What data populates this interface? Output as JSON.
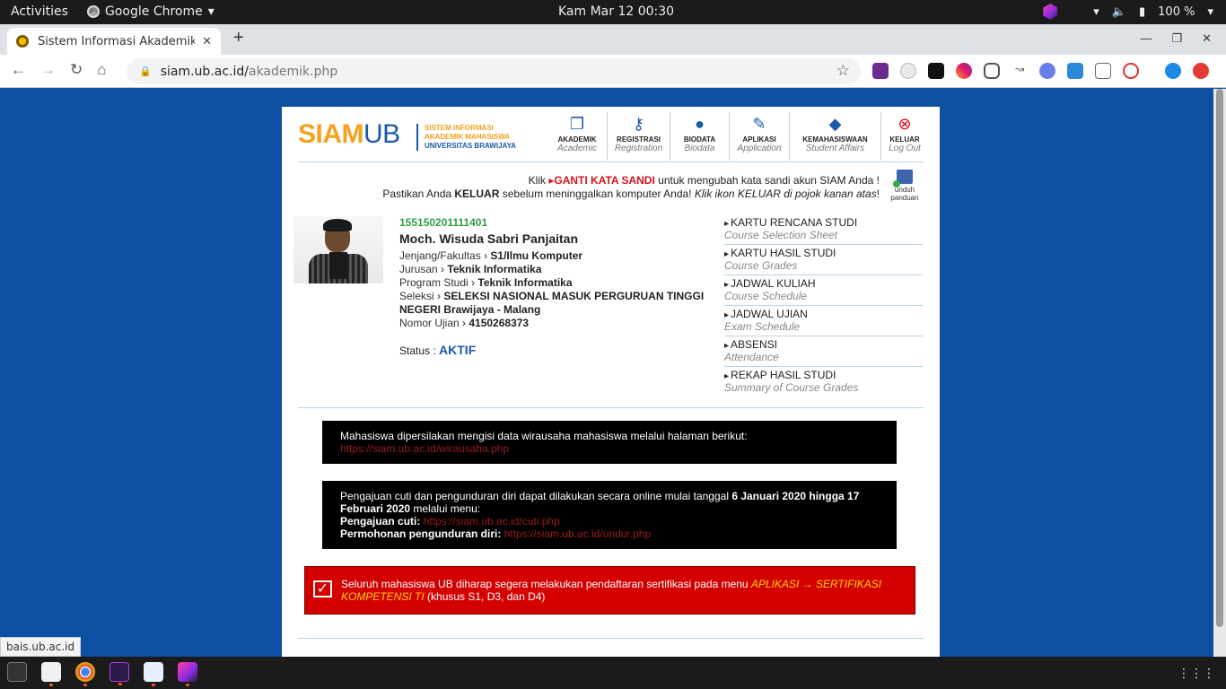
{
  "system": {
    "activities": "Activities",
    "app_name": "Google Chrome",
    "clock": "Kam Mar 12  00:30",
    "battery": "100 %"
  },
  "browser": {
    "tab_title": "Sistem Informasi Akademik",
    "url_host": "siam.ub.ac.id/",
    "url_path": "akademik.php",
    "status_url": "bais.ub.ac.id"
  },
  "logo": {
    "siam": "SIAM",
    "ub": "UB",
    "line1": "SISTEM INFORMASI",
    "line2": "AKADEMIK MAHASISWA",
    "line3": "UNIVERSITAS BRAWIJAYA"
  },
  "nav": [
    {
      "label": "AKADEMIK",
      "en": "Academic",
      "icon": "copy-icon"
    },
    {
      "label": "REGISTRASI",
      "en": "Registration",
      "icon": "key-icon"
    },
    {
      "label": "BIODATA",
      "en": "Biodata",
      "icon": "user-icon"
    },
    {
      "label": "APLIKASI",
      "en": "Application",
      "icon": "wrench-icon"
    },
    {
      "label": "KEMAHASISWAAN",
      "en": "Student Affairs",
      "icon": "graduation-cap-icon"
    },
    {
      "label": "KELUAR",
      "en": "Log Out",
      "icon": "close-circle-icon"
    }
  ],
  "notice": {
    "klik": "Klik",
    "ganti": "GANTI KATA SANDI",
    "line1_rest": "untuk mengubah kata sandi akun SIAM Anda !",
    "line2_a": "Pastikan Anda",
    "keluar": "KELUAR",
    "line2_b": "sebelum meninggalkan komputer Anda!",
    "line2_c": "Klik ikon KELUAR di pojok kanan atas",
    "line2_d": "!",
    "panduan1": "unduh",
    "panduan2": "panduan"
  },
  "student": {
    "nim": "155150201111401",
    "name": "Moch. Wisuda Sabri Panjaitan",
    "jenjang_label": "Jenjang/Fakultas",
    "jenjang": "S1/Ilmu Komputer",
    "jurusan_label": "Jurusan",
    "jurusan": "Teknik Informatika",
    "prodi_label": "Program Studi",
    "prodi": "Teknik Informatika",
    "seleksi_label": "Seleksi",
    "seleksi": "SELEKSI NASIONAL MASUK PERGURUAN TINGGI NEGERI Brawijaya - Malang",
    "ujian_label": "Nomor Ujian",
    "ujian": "4150268373",
    "status_label": "Status :",
    "status": "AKTIF"
  },
  "quick_links": [
    {
      "title": "KARTU RENCANA STUDI",
      "en": "Course Selection Sheet"
    },
    {
      "title": "KARTU HASIL STUDI",
      "en": "Course Grades"
    },
    {
      "title": "JADWAL KULIAH",
      "en": "Course Schedule"
    },
    {
      "title": "JADWAL UJIAN",
      "en": "Exam Schedule"
    },
    {
      "title": "ABSENSI",
      "en": "Attendance"
    },
    {
      "title": "REKAP HASIL STUDI",
      "en": "Summary of Course Grades"
    }
  ],
  "box1": {
    "text": "Mahasiswa dipersilakan mengisi data wirausaha mahasiswa melalui halaman berikut:",
    "link": "https://siam.ub.ac.id/wirausaha.php"
  },
  "box2": {
    "text_a": "Pengajuan cuti dan pengunduran diri dapat dilakukan secara online mulai tanggal",
    "date": "6 Januari 2020 hingga 17 Februari 2020",
    "text_b": "melalui menu:",
    "cuti_label": "Pengajuan cuti:",
    "cuti_link": "https://siam.ub.ac.id/cuti.php",
    "undur_label": "Permohonan pengunduran diri:",
    "undur_link": "https://siam.ub.ac.id/undur.php"
  },
  "box3": {
    "text_a": "Seluruh mahasiswa UB diharap segera melakukan pendaftaran sertifikasi pada menu",
    "menu": "APLIKASI → SERTIFIKASI KOMPETENSI TI",
    "text_b": "(khusus S1, D3, dan D4)"
  },
  "colors": {
    "background": "#0d4fa0",
    "brand_blue": "#1b5aa8",
    "brand_orange": "#f4a11d",
    "alert_red": "#d40000",
    "nim_green": "#2f9e44"
  }
}
